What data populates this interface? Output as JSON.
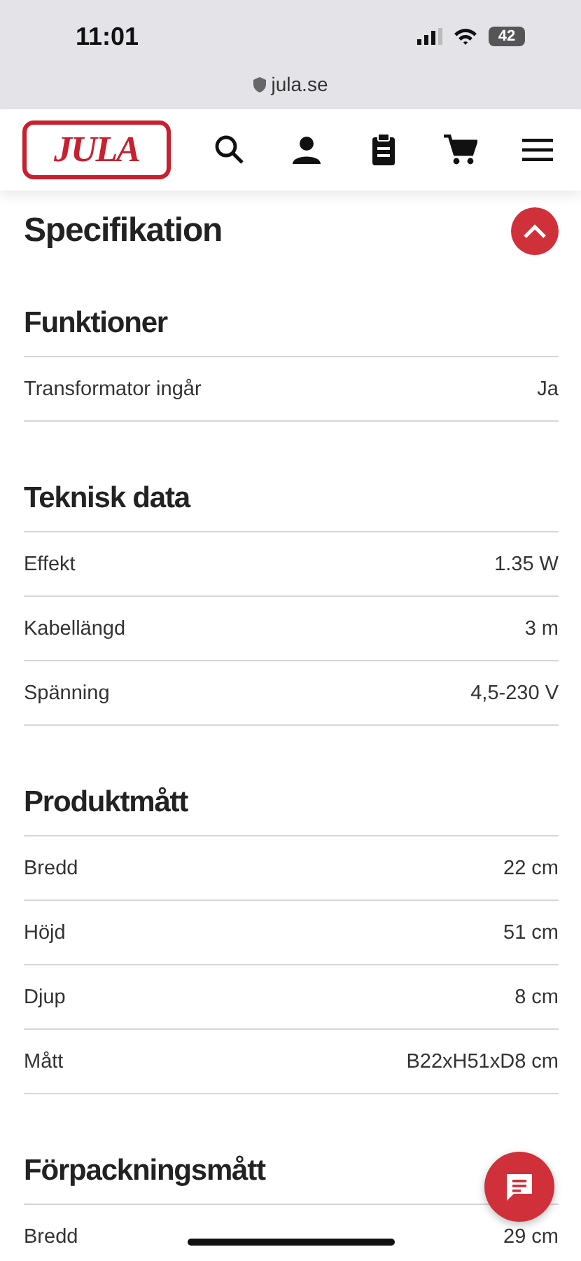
{
  "status_bar": {
    "time": "11:01",
    "battery": "42"
  },
  "address_bar": {
    "url": "jula.se"
  },
  "header": {
    "logo": "JULA"
  },
  "page_title": "Specifikation",
  "sections": [
    {
      "title": "Funktioner",
      "rows": [
        {
          "label": "Transformator ingår",
          "value": "Ja"
        }
      ]
    },
    {
      "title": "Teknisk data",
      "rows": [
        {
          "label": "Effekt",
          "value": "1.35 W"
        },
        {
          "label": "Kabellängd",
          "value": "3 m"
        },
        {
          "label": "Spänning",
          "value": "4,5-230 V"
        }
      ]
    },
    {
      "title": "Produktmått",
      "rows": [
        {
          "label": "Bredd",
          "value": "22 cm"
        },
        {
          "label": "Höjd",
          "value": "51 cm"
        },
        {
          "label": "Djup",
          "value": "8 cm"
        },
        {
          "label": "Mått",
          "value": "B22xH51xD8 cm"
        }
      ]
    },
    {
      "title": "Förpackningsmått",
      "rows": [
        {
          "label": "Bredd",
          "value": "29 cm"
        }
      ]
    }
  ]
}
